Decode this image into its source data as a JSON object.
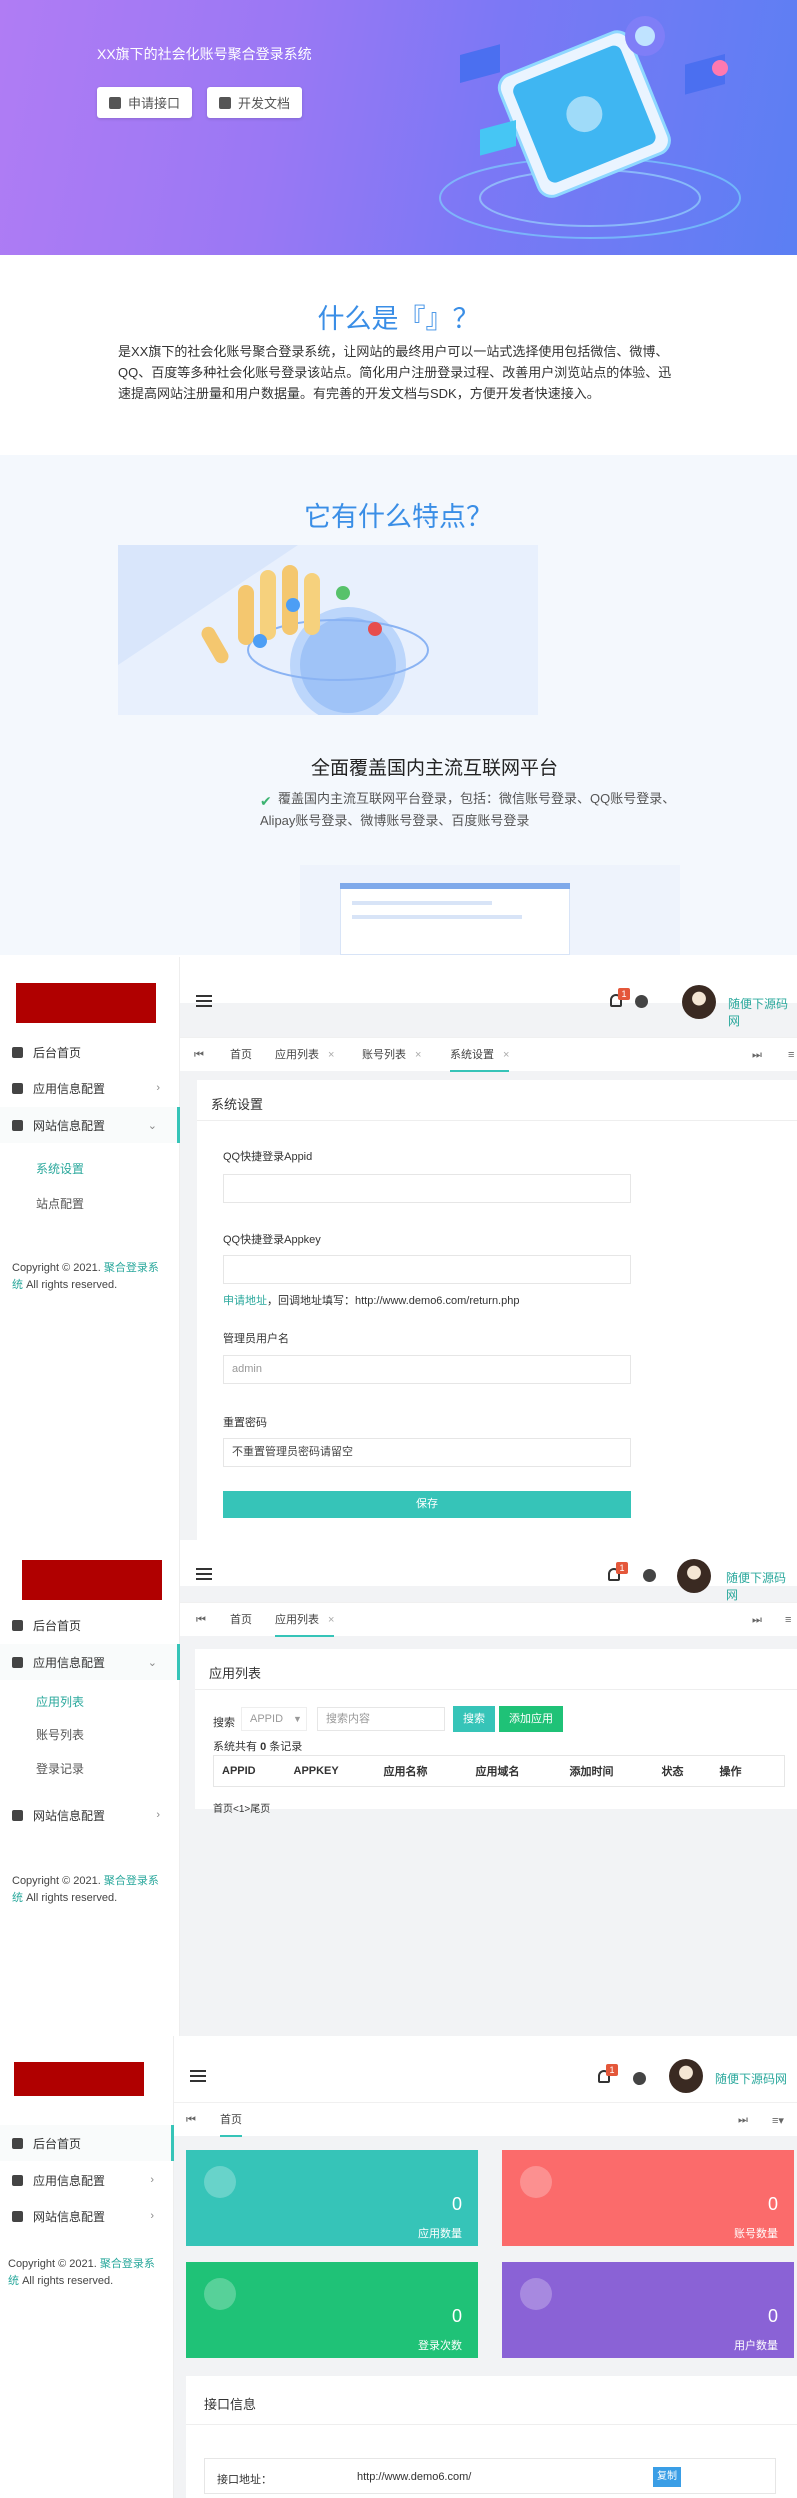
{
  "hero": {
    "title": "XX旗下的社会化账号聚合登录系统",
    "apply_btn": "申请接口",
    "docs_btn": "开发文档"
  },
  "what": {
    "title": "什么是『』？",
    "desc": "是XX旗下的社会化账号聚合登录系统，让网站的最终用户可以一站式选择使用包括微信、微博、QQ、百度等多种社会化账号登录该站点。简化用户注册登录过程、改善用户浏览站点的体验、迅速提高网站注册量和用户数据量。有完善的开发文档与SDK，方便开发者快速接入。"
  },
  "features": {
    "title": "它有什么特点？",
    "feature_title": "全面覆盖国内主流互联网平台",
    "feature_desc": "覆盖国内主流互联网平台登录，包括：微信账号登录、QQ账号登录、Alipay账号登录、微博账号登录、百度账号登录"
  },
  "admin": {
    "menu": {
      "home": "后台首页",
      "app_config": "应用信息配置",
      "site_config": "网站信息配置",
      "app_list": "应用列表",
      "account_list": "账号列表",
      "login_log": "登录记录",
      "system_settings": "系统设置",
      "site_settings": "站点配置"
    },
    "copyright_prefix": "Copyright © 2021.",
    "copyright_link": "聚合登录系统",
    "copyright_suffix": "All rights reserved.",
    "user_name": "随便下源码网",
    "badge": "1",
    "tabs": {
      "home": "首页",
      "app_list": "应用列表",
      "account_list": "账号列表",
      "system_settings": "系统设置"
    }
  },
  "settings": {
    "title": "系统设置",
    "qq_appid_label": "QQ快捷登录Appid",
    "qq_appid_value": "",
    "qq_appkey_label": "QQ快捷登录Appkey",
    "qq_appkey_value": "",
    "hint_link": "申请地址",
    "hint_text": "，回调地址填写：http://www.demo6.com/return.php",
    "admin_user_label": "管理员用户名",
    "admin_user_value": "admin",
    "reset_pwd_label": "重置密码",
    "reset_pwd_placeholder": "不重置管理员密码请留空",
    "save": "保存"
  },
  "app_list": {
    "title": "应用列表",
    "search_label": "搜索",
    "search_field": "APPID",
    "search_placeholder": "搜索内容",
    "search_btn": "搜索",
    "add_btn": "添加应用",
    "total_prefix": "系统共有",
    "total_count": "0",
    "total_suffix": "条记录",
    "columns": [
      "APPID",
      "APPKEY",
      "应用名称",
      "应用域名",
      "添加时间",
      "状态",
      "操作"
    ],
    "pagination": "首页<1>尾页"
  },
  "dashboard": {
    "stats": [
      {
        "value": "0",
        "label": "应用数量",
        "color": "#36c4b8"
      },
      {
        "value": "0",
        "label": "账号数量",
        "color": "#fb6b6b"
      },
      {
        "value": "0",
        "label": "登录次数",
        "color": "#1fc277"
      },
      {
        "value": "0",
        "label": "用户数量",
        "color": "#8a62d6"
      }
    ],
    "api_title": "接口信息",
    "api_label": "接口地址：",
    "api_url": "http://www.demo6.com/",
    "copy_btn": "复制"
  }
}
